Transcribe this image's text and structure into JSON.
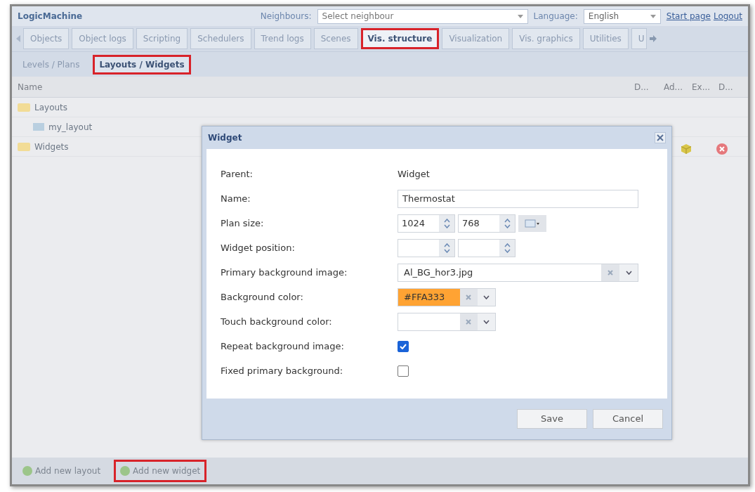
{
  "header": {
    "brand": "LogicMachine",
    "neighbours": {
      "label": "Neighbours:",
      "placeholder": "Select neighbour"
    },
    "language": {
      "label": "Language:",
      "value": "English"
    },
    "links": [
      "Start page",
      "Logout"
    ]
  },
  "tabs": [
    {
      "label": "Objects",
      "selected": false,
      "highlighted": false
    },
    {
      "label": "Object logs",
      "selected": false,
      "highlighted": false
    },
    {
      "label": "Scripting",
      "selected": false,
      "highlighted": false
    },
    {
      "label": "Schedulers",
      "selected": false,
      "highlighted": false
    },
    {
      "label": "Trend logs",
      "selected": false,
      "highlighted": false
    },
    {
      "label": "Scenes",
      "selected": false,
      "highlighted": false
    },
    {
      "label": "Vis. structure",
      "selected": true,
      "highlighted": true
    },
    {
      "label": "Visualization",
      "selected": false,
      "highlighted": false
    },
    {
      "label": "Vis. graphics",
      "selected": false,
      "highlighted": false
    },
    {
      "label": "Utilities",
      "selected": false,
      "highlighted": false
    },
    {
      "label": "U",
      "selected": false,
      "highlighted": false
    }
  ],
  "subtabs": [
    {
      "label": "Levels / Plans",
      "selected": false,
      "highlighted": false
    },
    {
      "label": "Layouts / Widgets",
      "selected": true,
      "highlighted": true
    }
  ],
  "table": {
    "columns": [
      "Name",
      "D...",
      "Ad...",
      "Ex...",
      "D..."
    ],
    "tree": [
      {
        "label": "Layouts",
        "kind": "folder",
        "children": [
          {
            "label": "my_layout",
            "kind": "layout"
          }
        ]
      },
      {
        "label": "Widgets",
        "kind": "folder"
      }
    ]
  },
  "dialog": {
    "title": "Widget",
    "fields": [
      {
        "kind": "text",
        "label": "Parent:",
        "value": "Widget"
      },
      {
        "kind": "input",
        "label": "Name:",
        "value": "Thermostat"
      },
      {
        "kind": "size",
        "label": "Plan size:",
        "values": [
          "1024",
          "768"
        ]
      },
      {
        "kind": "spin_pair",
        "label": "Widget position:"
      },
      {
        "kind": "select_clear",
        "label": "Primary background image:",
        "value": "Al_BG_hor3.jpg"
      },
      {
        "kind": "color",
        "label": "Background color:",
        "value": "#FFA333",
        "color": "#ffa333"
      },
      {
        "kind": "color",
        "label": "Touch background color:"
      },
      {
        "kind": "checkbox",
        "label": "Repeat background image:",
        "checked": true
      },
      {
        "kind": "checkbox",
        "label": "Fixed primary background:",
        "checked": false
      }
    ],
    "buttons": [
      "Save",
      "Cancel"
    ]
  },
  "toolbar": [
    {
      "label": "Add new layout",
      "highlighted": false
    },
    {
      "label": "Add new widget",
      "highlighted": true
    }
  ]
}
